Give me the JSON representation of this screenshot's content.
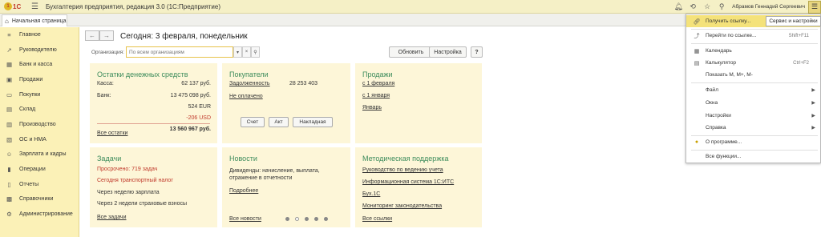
{
  "titlebar": {
    "logo_text": "1С",
    "title": "Бухгалтерия предприятия, редакция 3.0  (1С:Предприятие)",
    "user": "Абрамов Геннадий Сергеевич"
  },
  "tab": {
    "label": "Начальная страница"
  },
  "sidebar": {
    "items": [
      {
        "label": "Главное",
        "icon": "menu-icon"
      },
      {
        "label": "Руководителю",
        "icon": "chart-icon"
      },
      {
        "label": "Банк и касса",
        "icon": "bank-icon"
      },
      {
        "label": "Продажи",
        "icon": "sales-icon"
      },
      {
        "label": "Покупки",
        "icon": "cart-icon"
      },
      {
        "label": "Склад",
        "icon": "warehouse-icon"
      },
      {
        "label": "Производство",
        "icon": "factory-icon"
      },
      {
        "label": "ОС и НМА",
        "icon": "assets-icon"
      },
      {
        "label": "Зарплата и кадры",
        "icon": "people-icon"
      },
      {
        "label": "Операции",
        "icon": "operations-icon"
      },
      {
        "label": "Отчеты",
        "icon": "reports-icon"
      },
      {
        "label": "Справочники",
        "icon": "books-icon"
      },
      {
        "label": "Администрирование",
        "icon": "gear-icon"
      }
    ]
  },
  "main": {
    "title": "Сегодня: 3 февраля, понедельник",
    "org_label": "Организация:",
    "org_placeholder": "По всем организациям",
    "refresh_label": "Обновить",
    "settings_label": "Настройка",
    "help_label": "?"
  },
  "cash": {
    "title": "Остатки денежных средств",
    "kassa_label": "Касса:",
    "kassa_value": "62 137 руб.",
    "bank_label": "Банк:",
    "bank_rub": "13 475 098 руб.",
    "bank_eur": "524 EUR",
    "bank_usd": "-206 USD",
    "total": "13 560 967 руб.",
    "all_link": "Все остатки"
  },
  "buyers": {
    "title": "Покупатели",
    "debt_label": "Задолженность",
    "debt_value": "28 253 403",
    "unpaid_label": "Не оплачено",
    "btn_invoice": "Счет",
    "btn_act": "Акт",
    "btn_waybill": "Накладная"
  },
  "sales": {
    "title": "Продажи",
    "link1": "с 1 февраля",
    "link2": "с 1 января",
    "link3": "Январь"
  },
  "tasks": {
    "title": "Задачи",
    "overdue": "Просрочено: 719 задач",
    "today": "Сегодня транспортный налог",
    "week": "Через неделю зарплата",
    "two_weeks": "Через 2 недели страховые взносы",
    "all_link": "Все задачи"
  },
  "news": {
    "title": "Новости",
    "text": "Дивиденды: начисление, выплата, отражение в отчетности",
    "more_link": "Подробнее",
    "all_link": "Все новости",
    "pages": 5,
    "current_page": 2
  },
  "support": {
    "title": "Методическая поддержка",
    "links": [
      "Руководство по ведению учета",
      "Информационная система 1С:ИТС",
      "Бух.1С",
      "Мониторинг законодательства"
    ],
    "all_link": "Все ссылки"
  },
  "menu": {
    "tooltip": "Сервис и настройки",
    "items": [
      {
        "label": "Получить ссылку...",
        "shortcut": "",
        "icon": "link-icon",
        "highlight": true
      },
      {
        "label": "Перейти по ссылке...",
        "shortcut": "Shift+F11",
        "icon": "goto-link-icon"
      },
      {
        "label": "Календарь",
        "shortcut": "",
        "icon": "calendar-icon"
      },
      {
        "label": "Калькулятор",
        "shortcut": "Ctrl+F2",
        "icon": "calculator-icon"
      },
      {
        "label": "Показать М, М+, М-",
        "shortcut": ""
      },
      {
        "label": "Файл",
        "submenu": true
      },
      {
        "label": "Окна",
        "submenu": true
      },
      {
        "label": "Настройки",
        "submenu": true
      },
      {
        "label": "Справка",
        "submenu": true
      },
      {
        "label": "О программе...",
        "icon": "info-icon"
      },
      {
        "label": "Все функции..."
      }
    ]
  }
}
